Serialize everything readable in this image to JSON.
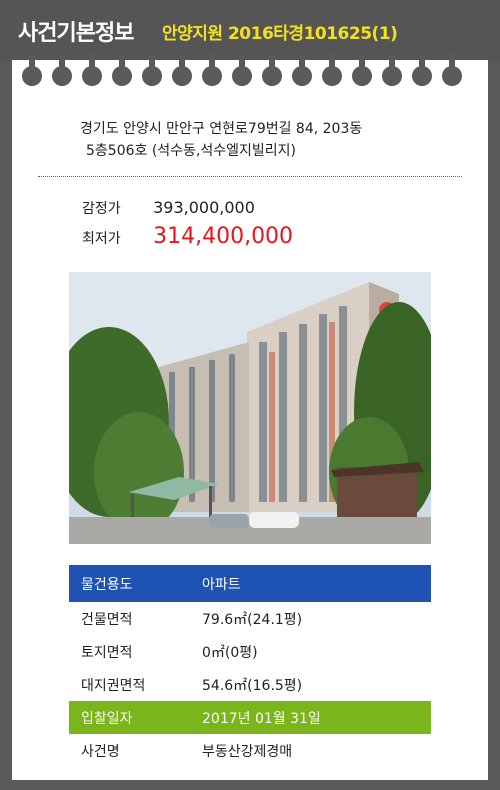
{
  "header": {
    "title": "사건기본정보",
    "case_number": "안양지원 2016타경101625(1)"
  },
  "property": {
    "address_line1": "경기도 안양시 만안구 연현로79번길 84, 203동",
    "address_line2": "5층506호 (석수동,석수엘지빌리지)"
  },
  "prices": {
    "appraisal_label": "감정가",
    "appraisal_value": "393,000,000",
    "minimum_label": "최저가",
    "minimum_value": "314,400,000"
  },
  "details": {
    "rows": [
      {
        "label": "물건용도",
        "value": "아파트"
      },
      {
        "label": "건물면적",
        "value": "79.6㎡(24.1평)"
      },
      {
        "label": "토지면적",
        "value": "0㎡(0평)"
      },
      {
        "label": "대지권면적",
        "value": "54.6㎡(16.5평)"
      },
      {
        "label": "입찰일자",
        "value": "2017년 01월 31일"
      },
      {
        "label": "사건명",
        "value": "부동산강제경매"
      }
    ]
  },
  "colors": {
    "header_bg": "#555555",
    "case_number": "#f3e11e",
    "minimum_price": "#e8141b",
    "row_usage_bg": "#1e52b3",
    "row_bid_date_bg": "#7bb51c"
  }
}
